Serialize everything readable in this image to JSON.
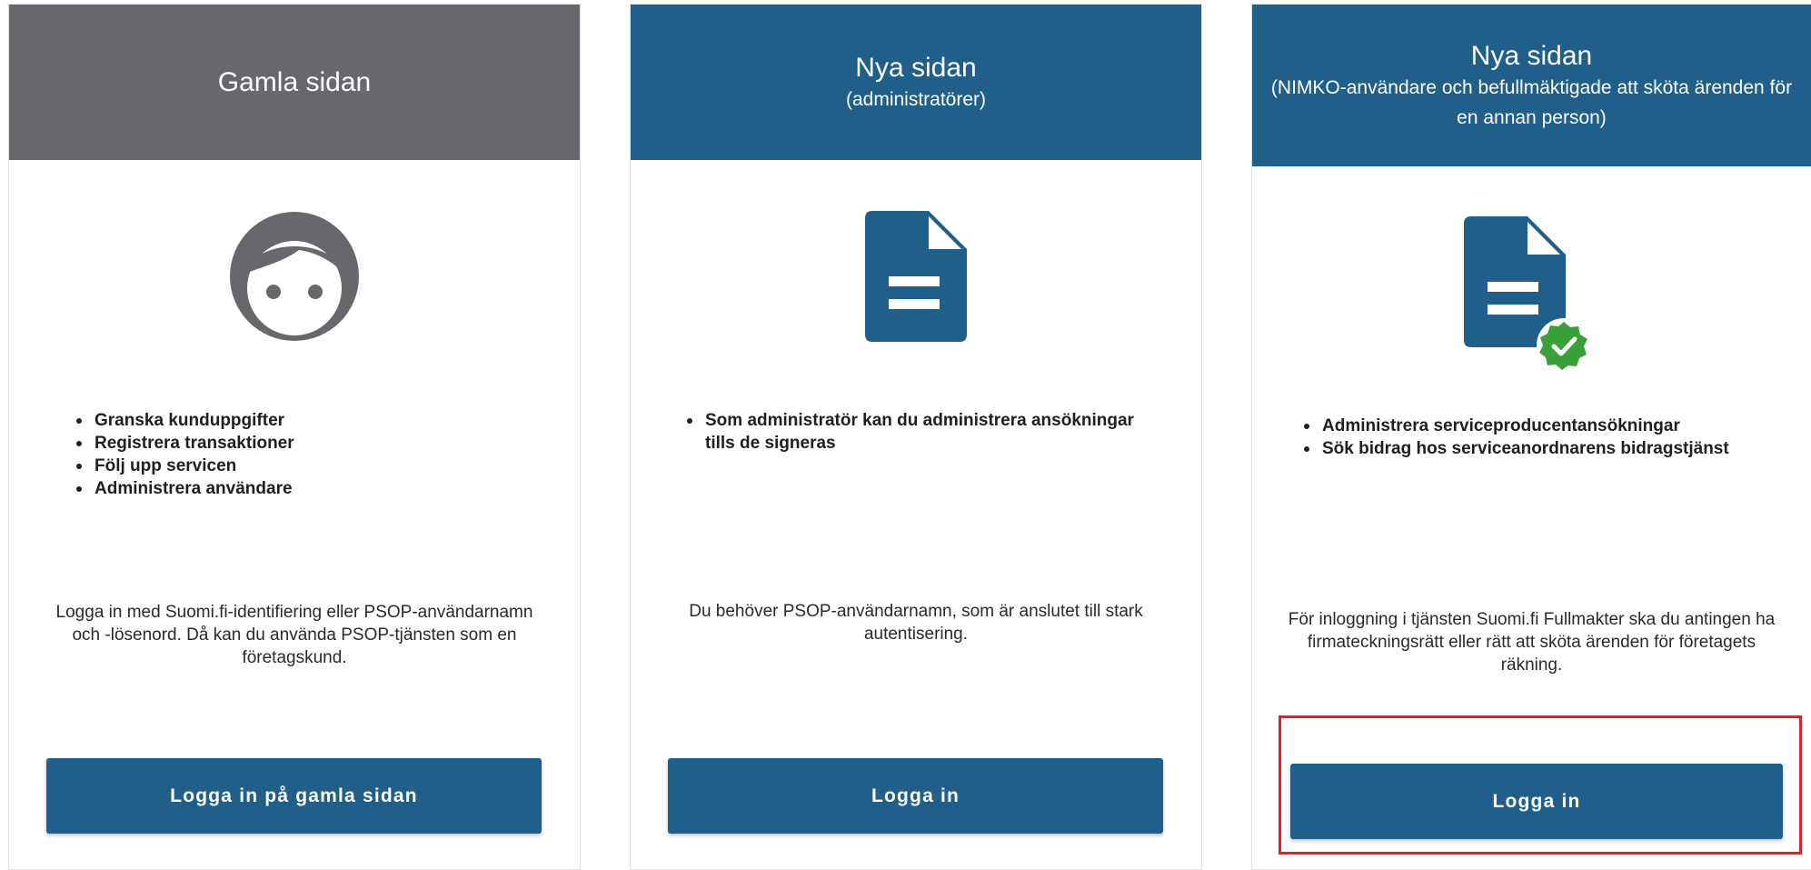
{
  "colors": {
    "old_header": "#68686c",
    "new_header": "#215f8b",
    "button": "#215f8b",
    "check_badge": "#3aa13a",
    "highlight": "#e32028"
  },
  "cards": [
    {
      "title": "Gamla sidan",
      "subtitle": "",
      "icon": "user-face-icon",
      "features": [
        "Granska kunduppgifter",
        "Registrera transaktioner",
        "Följ upp servicen",
        "Administrera användare"
      ],
      "description": "Logga in med Suomi.fi-identifiering eller PSOP-användarnamn och -lösenord. Då kan du använda PSOP-tjänsten som en företagskund.",
      "button": "Logga in på gamla sidan"
    },
    {
      "title": "Nya sidan",
      "subtitle": "(administratörer)",
      "icon": "document-icon",
      "features": [
        "Som administratör kan du administrera ansökningar tills de signeras"
      ],
      "description": "Du behöver PSOP-användarnamn, som är anslutet till stark autentisering.",
      "button": "Logga in"
    },
    {
      "title": "Nya sidan",
      "subtitle": "(NIMKO-användare och befullmäktigade att sköta ärenden för en annan person)",
      "icon": "verified-document-icon",
      "features": [
        "Administrera serviceproducentansökningar",
        "Sök bidrag hos serviceanordnarens bidragstjänst"
      ],
      "description": "För inloggning i tjänsten Suomi.fi Fullmakter ska du antingen ha firmateckningsrätt eller rätt att sköta ärenden för företagets räkning.",
      "button": "Logga in"
    }
  ]
}
